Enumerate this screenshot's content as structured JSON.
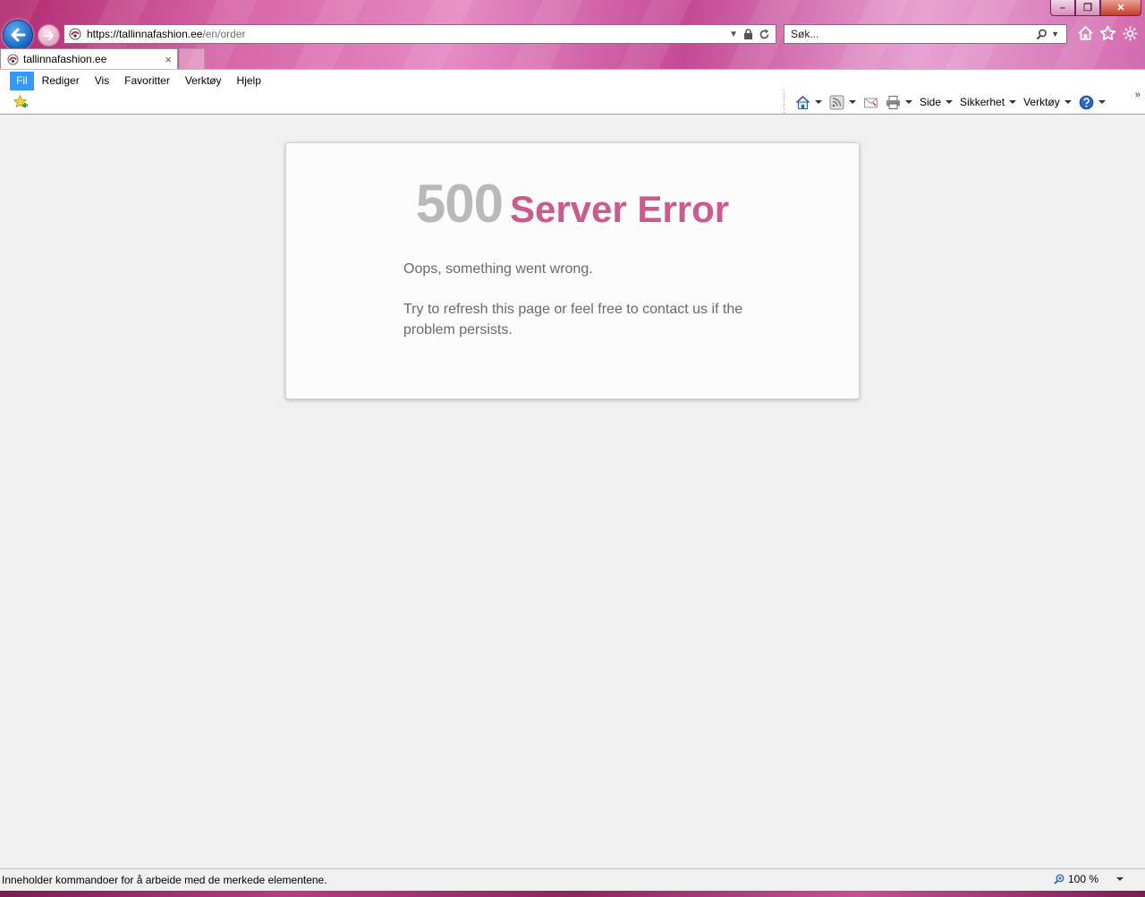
{
  "browser": {
    "address": {
      "domain": "https://tallinnafashion.ee",
      "path": "/en/order"
    },
    "search": {
      "placeholder": "Søk..."
    },
    "tab": {
      "label": "tallinnafashion.ee",
      "close": "×"
    },
    "window_buttons": {
      "min": "–",
      "max": "❐",
      "close": "✕"
    },
    "menu": [
      {
        "label": "Fil"
      },
      {
        "label": "Rediger"
      },
      {
        "label": "Vis"
      },
      {
        "label": "Favoritter"
      },
      {
        "label": "Verktøy"
      },
      {
        "label": "Hjelp"
      }
    ],
    "command_bar": {
      "page": "Side",
      "safety": "Sikkerhet",
      "tools": "Verktøy"
    },
    "status_text": "Inneholder kommandoer for å arbeide med de merkede elementene.",
    "zoom": "100 %"
  },
  "page": {
    "error_code": "500",
    "error_title": "Server Error",
    "message_1": "Oops, something went wrong.",
    "message_2": "Try to refresh this page or feel free to contact us if the problem persists."
  },
  "colors": {
    "error_title": "#cc5a8e",
    "error_code": "#b9b9b9",
    "menu_active": "#3399ff"
  }
}
